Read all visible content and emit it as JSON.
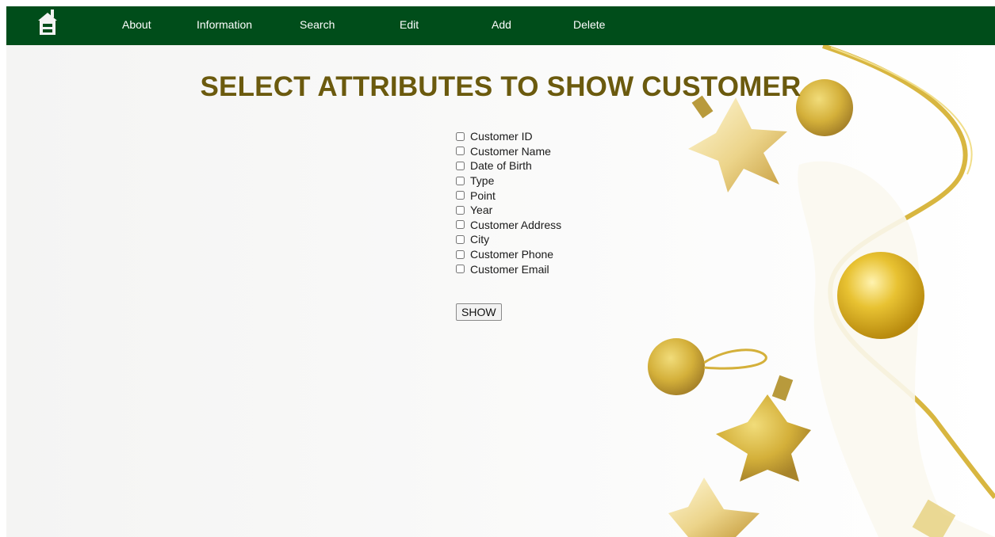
{
  "nav": {
    "logo_icon": "home-icon",
    "items": [
      "About",
      "Information",
      "Search",
      "Edit",
      "Add",
      "Delete"
    ],
    "background": "#004d1a"
  },
  "page": {
    "title": "SELECT ATTRIBUTES TO SHOW CUSTOMER",
    "title_color": "#6b5a0e"
  },
  "attributes": [
    "Customer ID",
    "Customer Name",
    "Date of Birth",
    "Type",
    "Point",
    "Year",
    "Customer Address",
    "City",
    "Customer Phone",
    "Customer Email"
  ],
  "show_button": "SHOW"
}
